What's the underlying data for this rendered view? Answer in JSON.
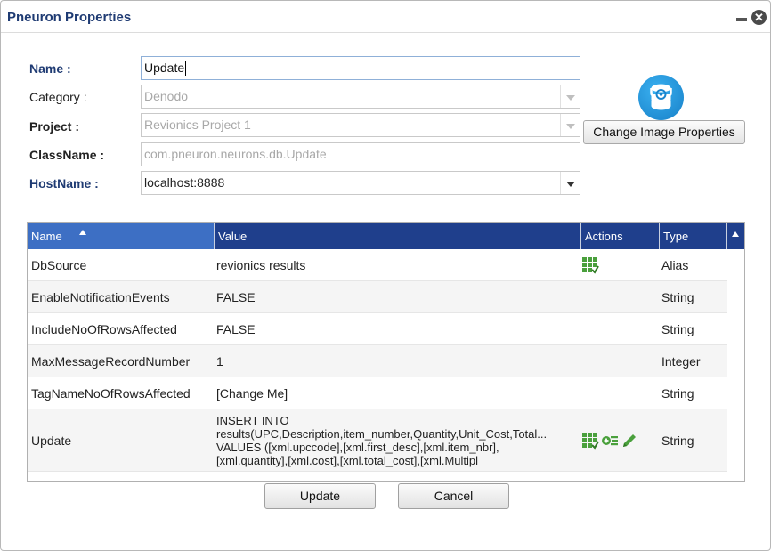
{
  "dialog": {
    "title": "Pneuron Properties",
    "close_glyph": "✕"
  },
  "form": {
    "name_label": "Name :",
    "name_value": "Update",
    "category_label": "Category :",
    "category_value": "Denodo",
    "project_label": "Project :",
    "project_value": "Revionics Project 1",
    "classname_label": "ClassName :",
    "classname_value": "com.pneuron.neurons.db.Update",
    "hostname_label": "HostName :",
    "hostname_value": "localhost:8888"
  },
  "image_button": {
    "label": "Change Image Properties",
    "icon": "database-icon"
  },
  "grid": {
    "columns": [
      "Name",
      "Value",
      "Actions",
      "Type"
    ],
    "sort": {
      "column": "Name",
      "direction": "ascending"
    },
    "rows": [
      {
        "name": "DbSource",
        "value": "revionics results",
        "type": "Alias",
        "actions": [
          "grid-select-icon"
        ]
      },
      {
        "name": "EnableNotificationEvents",
        "value": "FALSE",
        "type": "String",
        "actions": []
      },
      {
        "name": "IncludeNoOfRowsAffected",
        "value": "FALSE",
        "type": "String",
        "actions": []
      },
      {
        "name": "MaxMessageRecordNumber",
        "value": "1",
        "type": "Integer",
        "actions": []
      },
      {
        "name": "TagNameNoOfRowsAffected",
        "value": "[Change Me]",
        "type": "String",
        "actions": []
      },
      {
        "name": "Update",
        "value_lines": [
          "INSERT INTO",
          "results(UPC,Description,item_number,Quantity,Unit_Cost,Total...",
          "VALUES ([xml.upccode],[xml.first_desc],[xml.item_nbr],",
          "[xml.quantity],[xml.cost],[xml.total_cost],[xml.Multipl"
        ],
        "type": "String",
        "actions": [
          "grid-select-icon",
          "add-list-icon",
          "edit-pencil-icon"
        ]
      }
    ]
  },
  "footer": {
    "update_label": "Update",
    "cancel_label": "Cancel"
  },
  "colors": {
    "header_bg": "#1f3f8c",
    "sorted_header_bg": "#3d6fc4",
    "title": "#1f3b73",
    "icon_green": "#4aa03c"
  }
}
